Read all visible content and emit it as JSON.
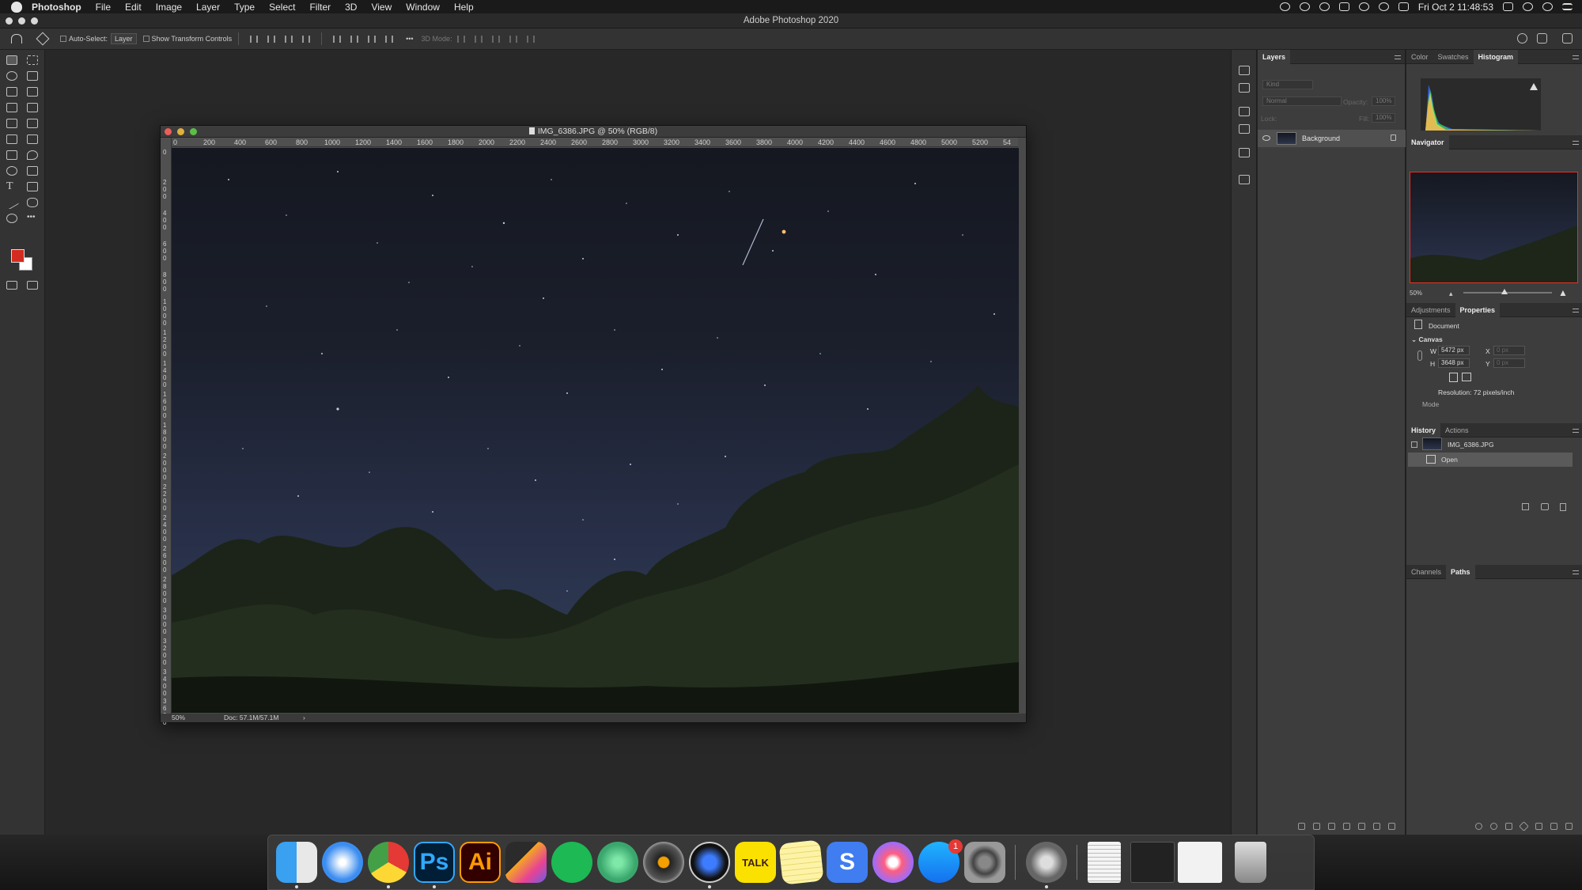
{
  "menubar": {
    "app": "Photoshop",
    "items": [
      "File",
      "Edit",
      "Image",
      "Layer",
      "Type",
      "Select",
      "Filter",
      "3D",
      "View",
      "Window",
      "Help"
    ],
    "clock": "Fri Oct 2  11:48:53"
  },
  "window": {
    "title": "Adobe Photoshop 2020"
  },
  "options": {
    "auto_select_label": "Auto-Select:",
    "auto_select_value": "Layer",
    "show_transform_label": "Show Transform Controls",
    "mode_3d_label": "3D Mode:"
  },
  "document": {
    "title": "IMG_6386.JPG @ 50% (RGB/8)",
    "ruler_h": [
      "0",
      "200",
      "400",
      "600",
      "800",
      "1000",
      "1200",
      "1400",
      "1600",
      "1800",
      "2000",
      "2200",
      "2400",
      "2600",
      "2800",
      "3000",
      "3200",
      "3400",
      "3600",
      "3800",
      "4000",
      "4200",
      "4400",
      "4600",
      "4800",
      "5000",
      "5200",
      "54"
    ],
    "ruler_v": [
      "0",
      "2 0 0",
      "4 0 0",
      "6 0 0",
      "8 0 0",
      "1 0 0 0",
      "1 2 0 0",
      "1 4 0 0",
      "1 6 0 0",
      "1 8 0 0",
      "2 0 0 0",
      "2 2 0 0",
      "2 4 0 0",
      "2 6 0 0",
      "2 8 0 0",
      "3 0 0 0",
      "3 2 0 0",
      "3 4 0 0",
      "3 6 0 0"
    ],
    "zoom": "50%",
    "doc_info": "Doc: 57.1M/57.1M",
    "arrow": "›"
  },
  "layers_panel": {
    "tab": "Layers",
    "filter_placeholder": "Kind",
    "blend_mode": "Normal",
    "opacity_label": "Opacity:",
    "opacity_value": "100%",
    "lock_label": "Lock:",
    "fill_label": "Fill:",
    "fill_value": "100%",
    "layer_name": "Background"
  },
  "top_right_tabs": [
    "Color",
    "Swatches",
    "Histogram"
  ],
  "navigator": {
    "tab": "Navigator",
    "zoom": "50%"
  },
  "props_tabs": [
    "Adjustments",
    "Properties"
  ],
  "properties": {
    "document_label": "Document",
    "canvas_label": "Canvas",
    "w_label": "W",
    "w_value": "5472 px",
    "h_label": "H",
    "h_value": "3648 px",
    "x_label": "X",
    "x_value": "0 px",
    "y_label": "Y",
    "y_value": "0 px",
    "resolution": "Resolution: 72 pixels/inch",
    "mode_label": "Mode"
  },
  "history_tabs": [
    "History",
    "Actions"
  ],
  "history": {
    "snapshot": "IMG_6386.JPG",
    "step": "Open"
  },
  "channels_tabs": [
    "Channels",
    "Paths"
  ],
  "dock": {
    "photoshop_label": "Ps",
    "illustrator_label": "Ai",
    "kakaotalk_label": "TALK",
    "skype_label": "S",
    "appstore_badge": "1"
  },
  "colors": {
    "foreground": "#d32b1f",
    "background": "#ffffff",
    "accent": "#e3322a"
  }
}
